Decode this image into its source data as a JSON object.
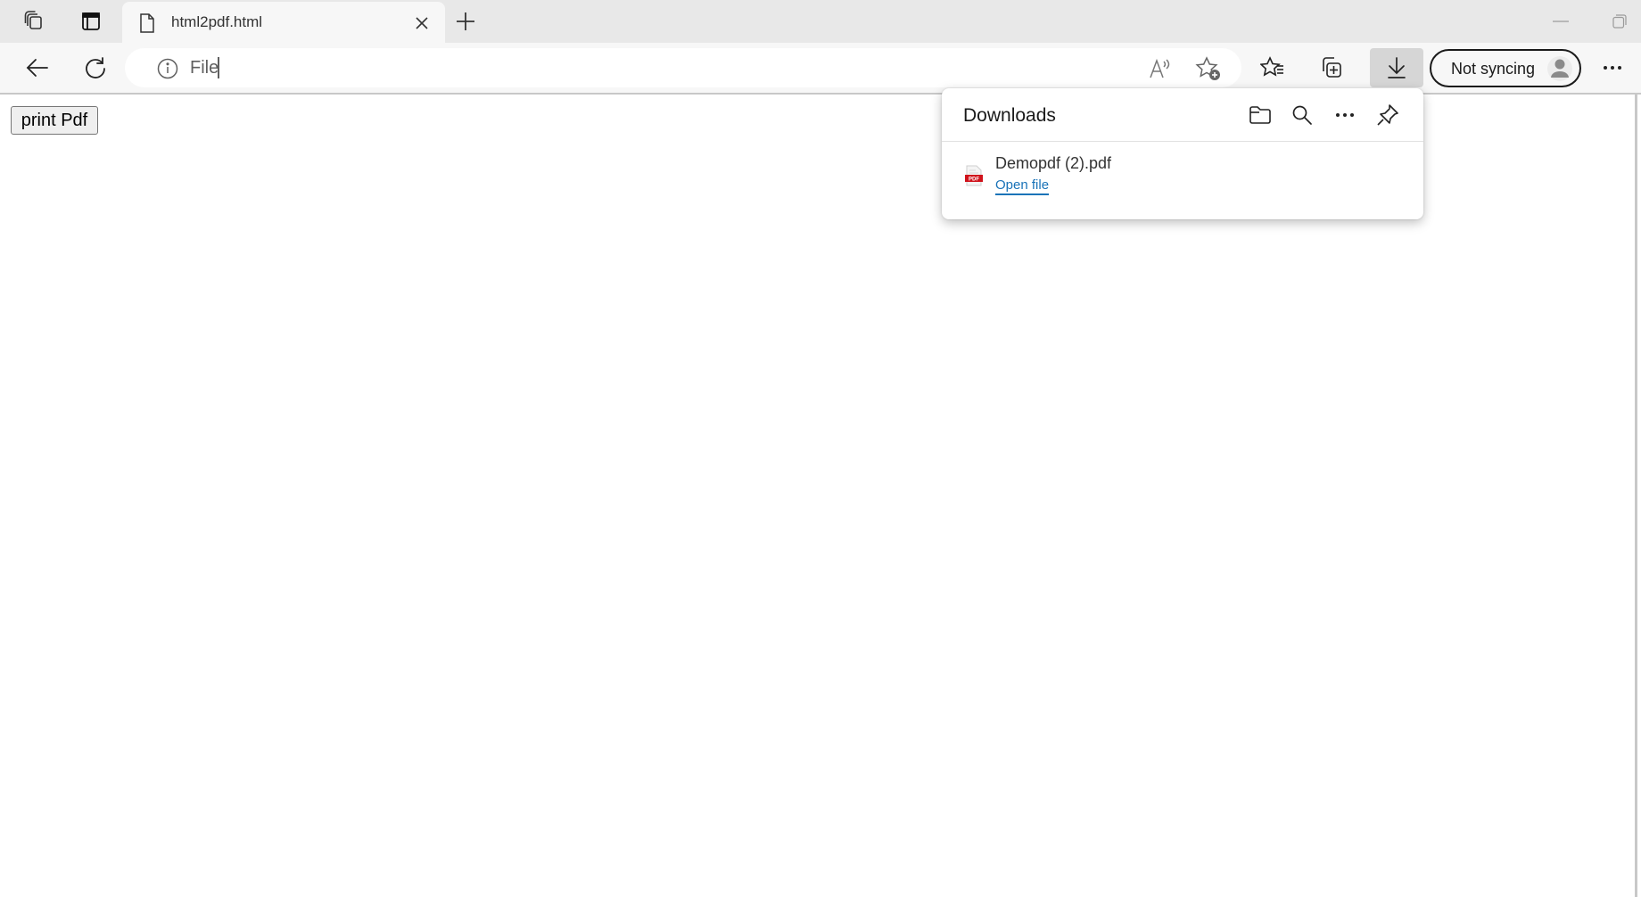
{
  "browser": {
    "tab": {
      "title": "html2pdf.html",
      "icon": "document-icon"
    },
    "tabstrip_icons": [
      "workspaces-icon",
      "tab-actions-icon"
    ],
    "address_bar": {
      "scheme_label": "File",
      "value": ""
    },
    "toolbar_icons": [
      "back-icon",
      "refresh-icon",
      "read-aloud-icon",
      "add-favorite-icon",
      "favorites-icon",
      "collections-icon",
      "downloads-icon",
      "more-icon"
    ],
    "profile": {
      "label": "Not syncing"
    }
  },
  "page": {
    "print_button_label": "print Pdf"
  },
  "downloads_panel": {
    "title": "Downloads",
    "header_icons": [
      "open-folder-icon",
      "search-icon",
      "more-options-icon",
      "pin-icon"
    ],
    "items": [
      {
        "file_name": "Demopdf (2).pdf",
        "action_label": "Open file",
        "file_type": "PDF"
      }
    ]
  },
  "colors": {
    "link": "#1a73b8",
    "pdf_badge": "#d0121b",
    "tabstrip_bg": "#e8e8e8",
    "toolbar_bg": "#f7f7f7"
  }
}
